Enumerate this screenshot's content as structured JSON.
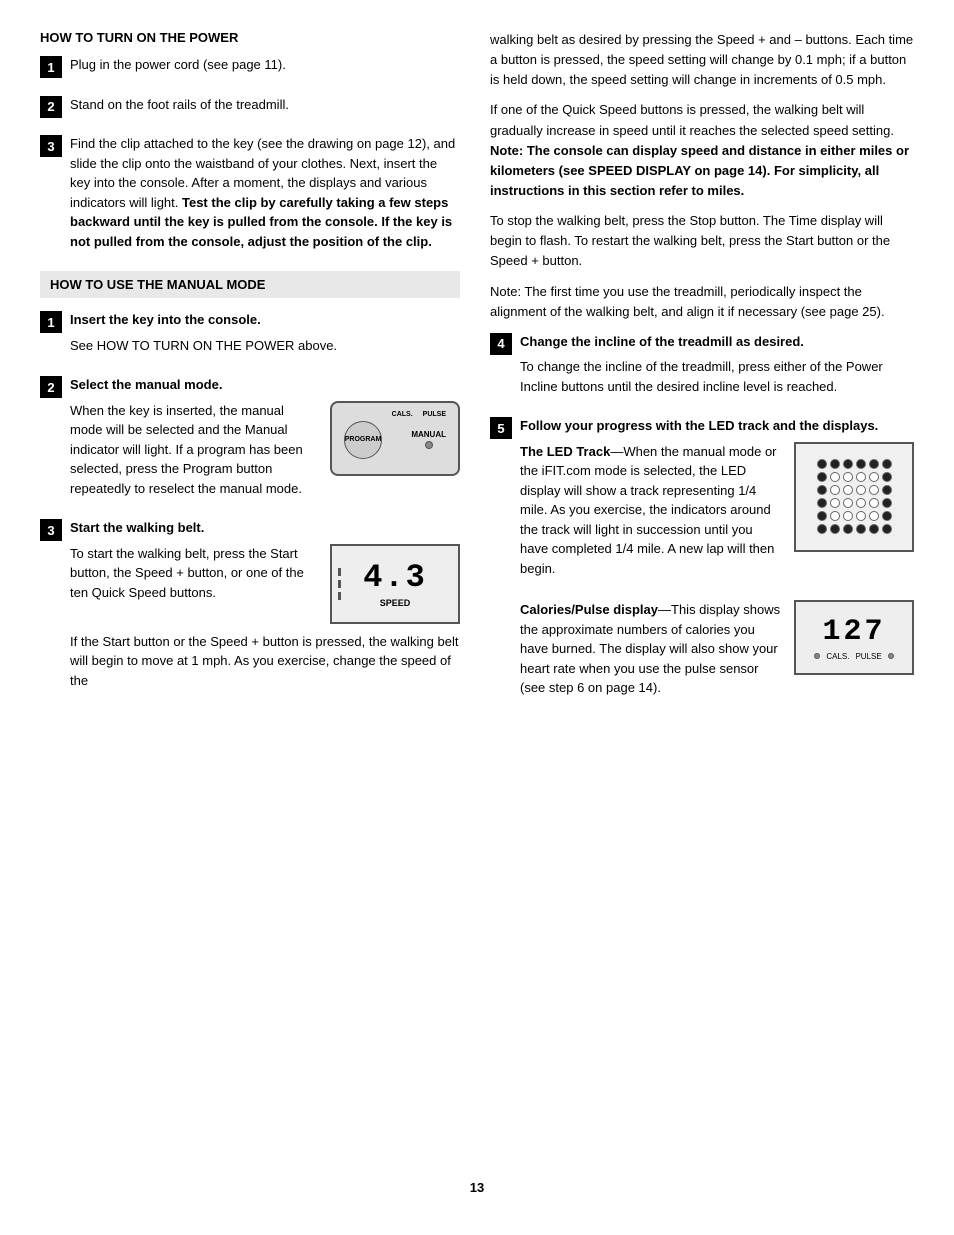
{
  "left": {
    "section1_title": "HOW TO TURN ON THE POWER",
    "step1_label": "1",
    "step1_text": "Plug in the power cord (see page 11).",
    "step2_label": "2",
    "step2_text": "Stand on the foot rails of the treadmill.",
    "step3_label": "3",
    "step3_text_start": "Find the clip attached to the key (see the drawing on page 12), and slide the clip onto the waistband of your clothes. Next, insert the key into the console. After a moment, the displays and various indicators will light.",
    "step3_bold": "Test the clip by carefully taking a few steps backward until the key is pulled from the console. If the key is not pulled from the console, adjust the position of the clip.",
    "section2_title": "HOW TO USE THE MANUAL MODE",
    "manual_step1_label": "1",
    "manual_step1_bold": "Insert the key into the console.",
    "manual_step1_text": "See HOW TO TURN ON THE POWER above.",
    "manual_step2_label": "2",
    "manual_step2_bold": "Select the manual mode.",
    "manual_step2_text1": "When the key is inserted, the manual mode will be selected and the Manual indicator will light. If a program has been selected, press the Program button repeatedly to reselect the manual mode.",
    "console_program": "PROGRAM",
    "console_manual": "MANUAL",
    "console_cals": "CALS.",
    "console_pulse": "PULSE",
    "manual_step3_label": "3",
    "manual_step3_bold": "Start the walking belt.",
    "manual_step3_text1": "To start the walking belt, press the Start button, the Speed + button, or one of the ten Quick Speed buttons.",
    "speed_value": "4.3",
    "speed_label": "SPEED",
    "manual_step3_text2": "If the Start button or the Speed + button is pressed, the walking belt will begin to move at 1 mph. As you exercise, change the speed of the"
  },
  "right": {
    "para1": "walking belt as desired by pressing the Speed + and – buttons. Each time a button is pressed, the speed setting will change by 0.1 mph; if a button is held down, the speed setting will change in increments of 0.5 mph.",
    "para2": "If one of the Quick Speed buttons is pressed, the walking belt will gradually increase in speed until it reaches the selected speed setting.",
    "para2_bold": "Note: The console can display speed and distance in either miles or kilometers (see SPEED DISPLAY on page 14). For simplicity, all instructions in this section refer to miles.",
    "para3": "To stop the walking belt, press the Stop button. The Time display will begin to flash. To restart the walking belt, press the Start button or the Speed + button.",
    "para4": "Note: The first time you use the treadmill, periodically inspect the alignment of the walking belt, and align it if necessary (see page 25).",
    "step4_label": "4",
    "step4_bold": "Change the incline of the treadmill as desired.",
    "step4_text": "To change the incline of the treadmill, press either of the Power Incline buttons until the desired incline level is reached.",
    "step5_label": "5",
    "step5_bold": "Follow your progress with the LED track and the displays.",
    "led_section_bold": "The LED Track",
    "led_section_text": "—When the manual mode or the iFIT.com mode is selected, the LED display will show a track representing 1/4 mile. As you exercise, the indicators around the track will light in succession until you have completed 1/4 mile. A new lap will then begin.",
    "cals_bold": "Calories/Pulse display",
    "cals_text": "—This display shows the approximate numbers of calories you have burned. The display will also show your heart rate when you use the pulse sensor (see step 6 on page 14).",
    "cals_value": "127",
    "cals_label": "CALS.",
    "pulse_label": "PULSE"
  },
  "page_number": "13"
}
